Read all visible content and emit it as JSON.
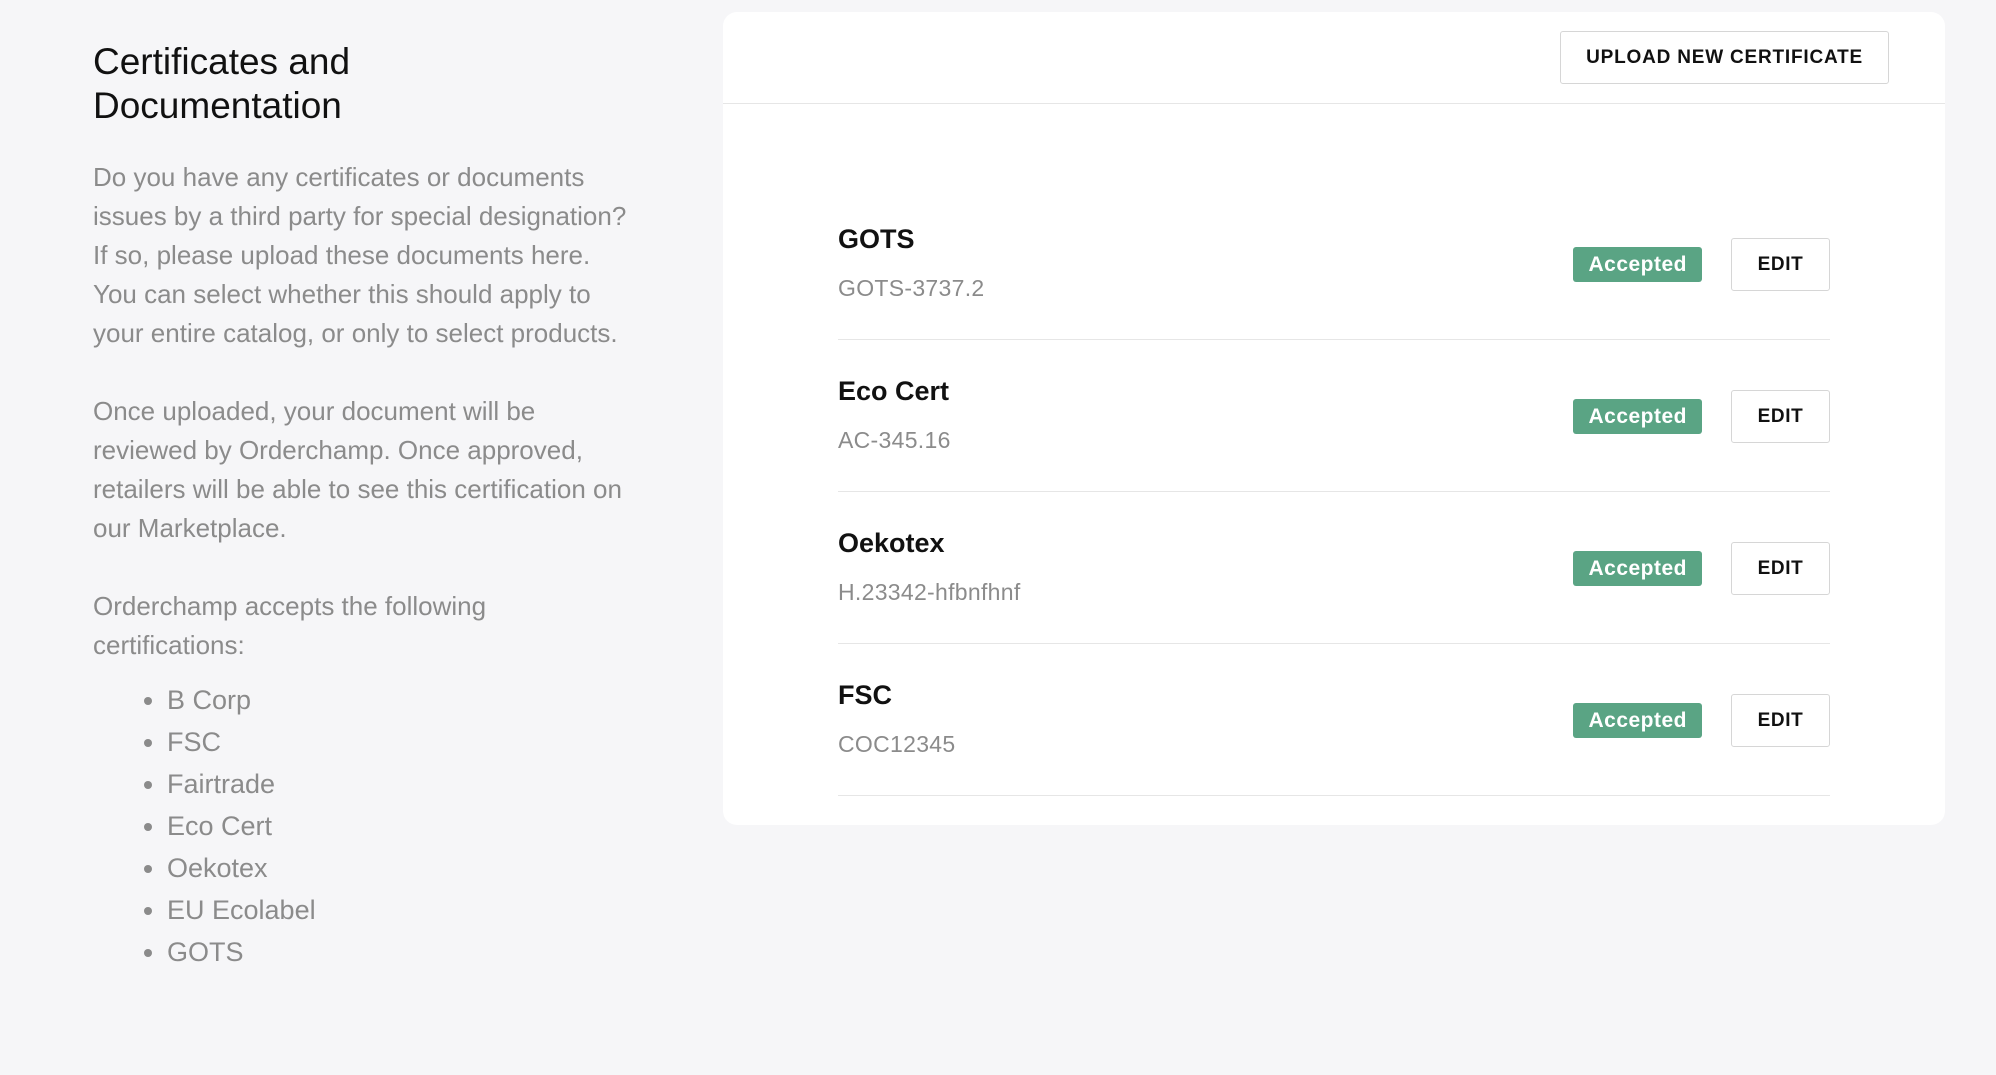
{
  "intro": {
    "title": "Certificates and Documentation",
    "paragraph_1": "Do you have any certificates or documents issues by a third party for special designation? If so, please upload these documents here. You can select whether this should apply to your entire catalog, or only to select products.",
    "paragraph_2": "Once uploaded, your document will be reviewed by Orderchamp. Once approved, retailers will be able to see this certification on our Marketplace.",
    "paragraph_3": "Orderchamp accepts the following certifications:",
    "accepted_certifications": [
      "B Corp",
      "FSC",
      "Fairtrade",
      "Eco Cert",
      "Oekotex",
      "EU Ecolabel",
      "GOTS"
    ]
  },
  "card": {
    "upload_label": "UPLOAD NEW CERTIFICATE",
    "certificates": [
      {
        "name": "GOTS",
        "code": "GOTS-3737.2",
        "status": "Accepted",
        "edit_label": "EDIT"
      },
      {
        "name": "Eco Cert",
        "code": "AC-345.16",
        "status": "Accepted",
        "edit_label": "EDIT"
      },
      {
        "name": "Oekotex",
        "code": "H.23342-hfbnfhnf",
        "status": "Accepted",
        "edit_label": "EDIT"
      },
      {
        "name": "FSC",
        "code": "COC12345",
        "status": "Accepted",
        "edit_label": "EDIT"
      }
    ]
  },
  "colors": {
    "accepted_badge": "#5aa484",
    "muted_text": "#8b8b8b",
    "page_background": "#f6f6f8"
  }
}
